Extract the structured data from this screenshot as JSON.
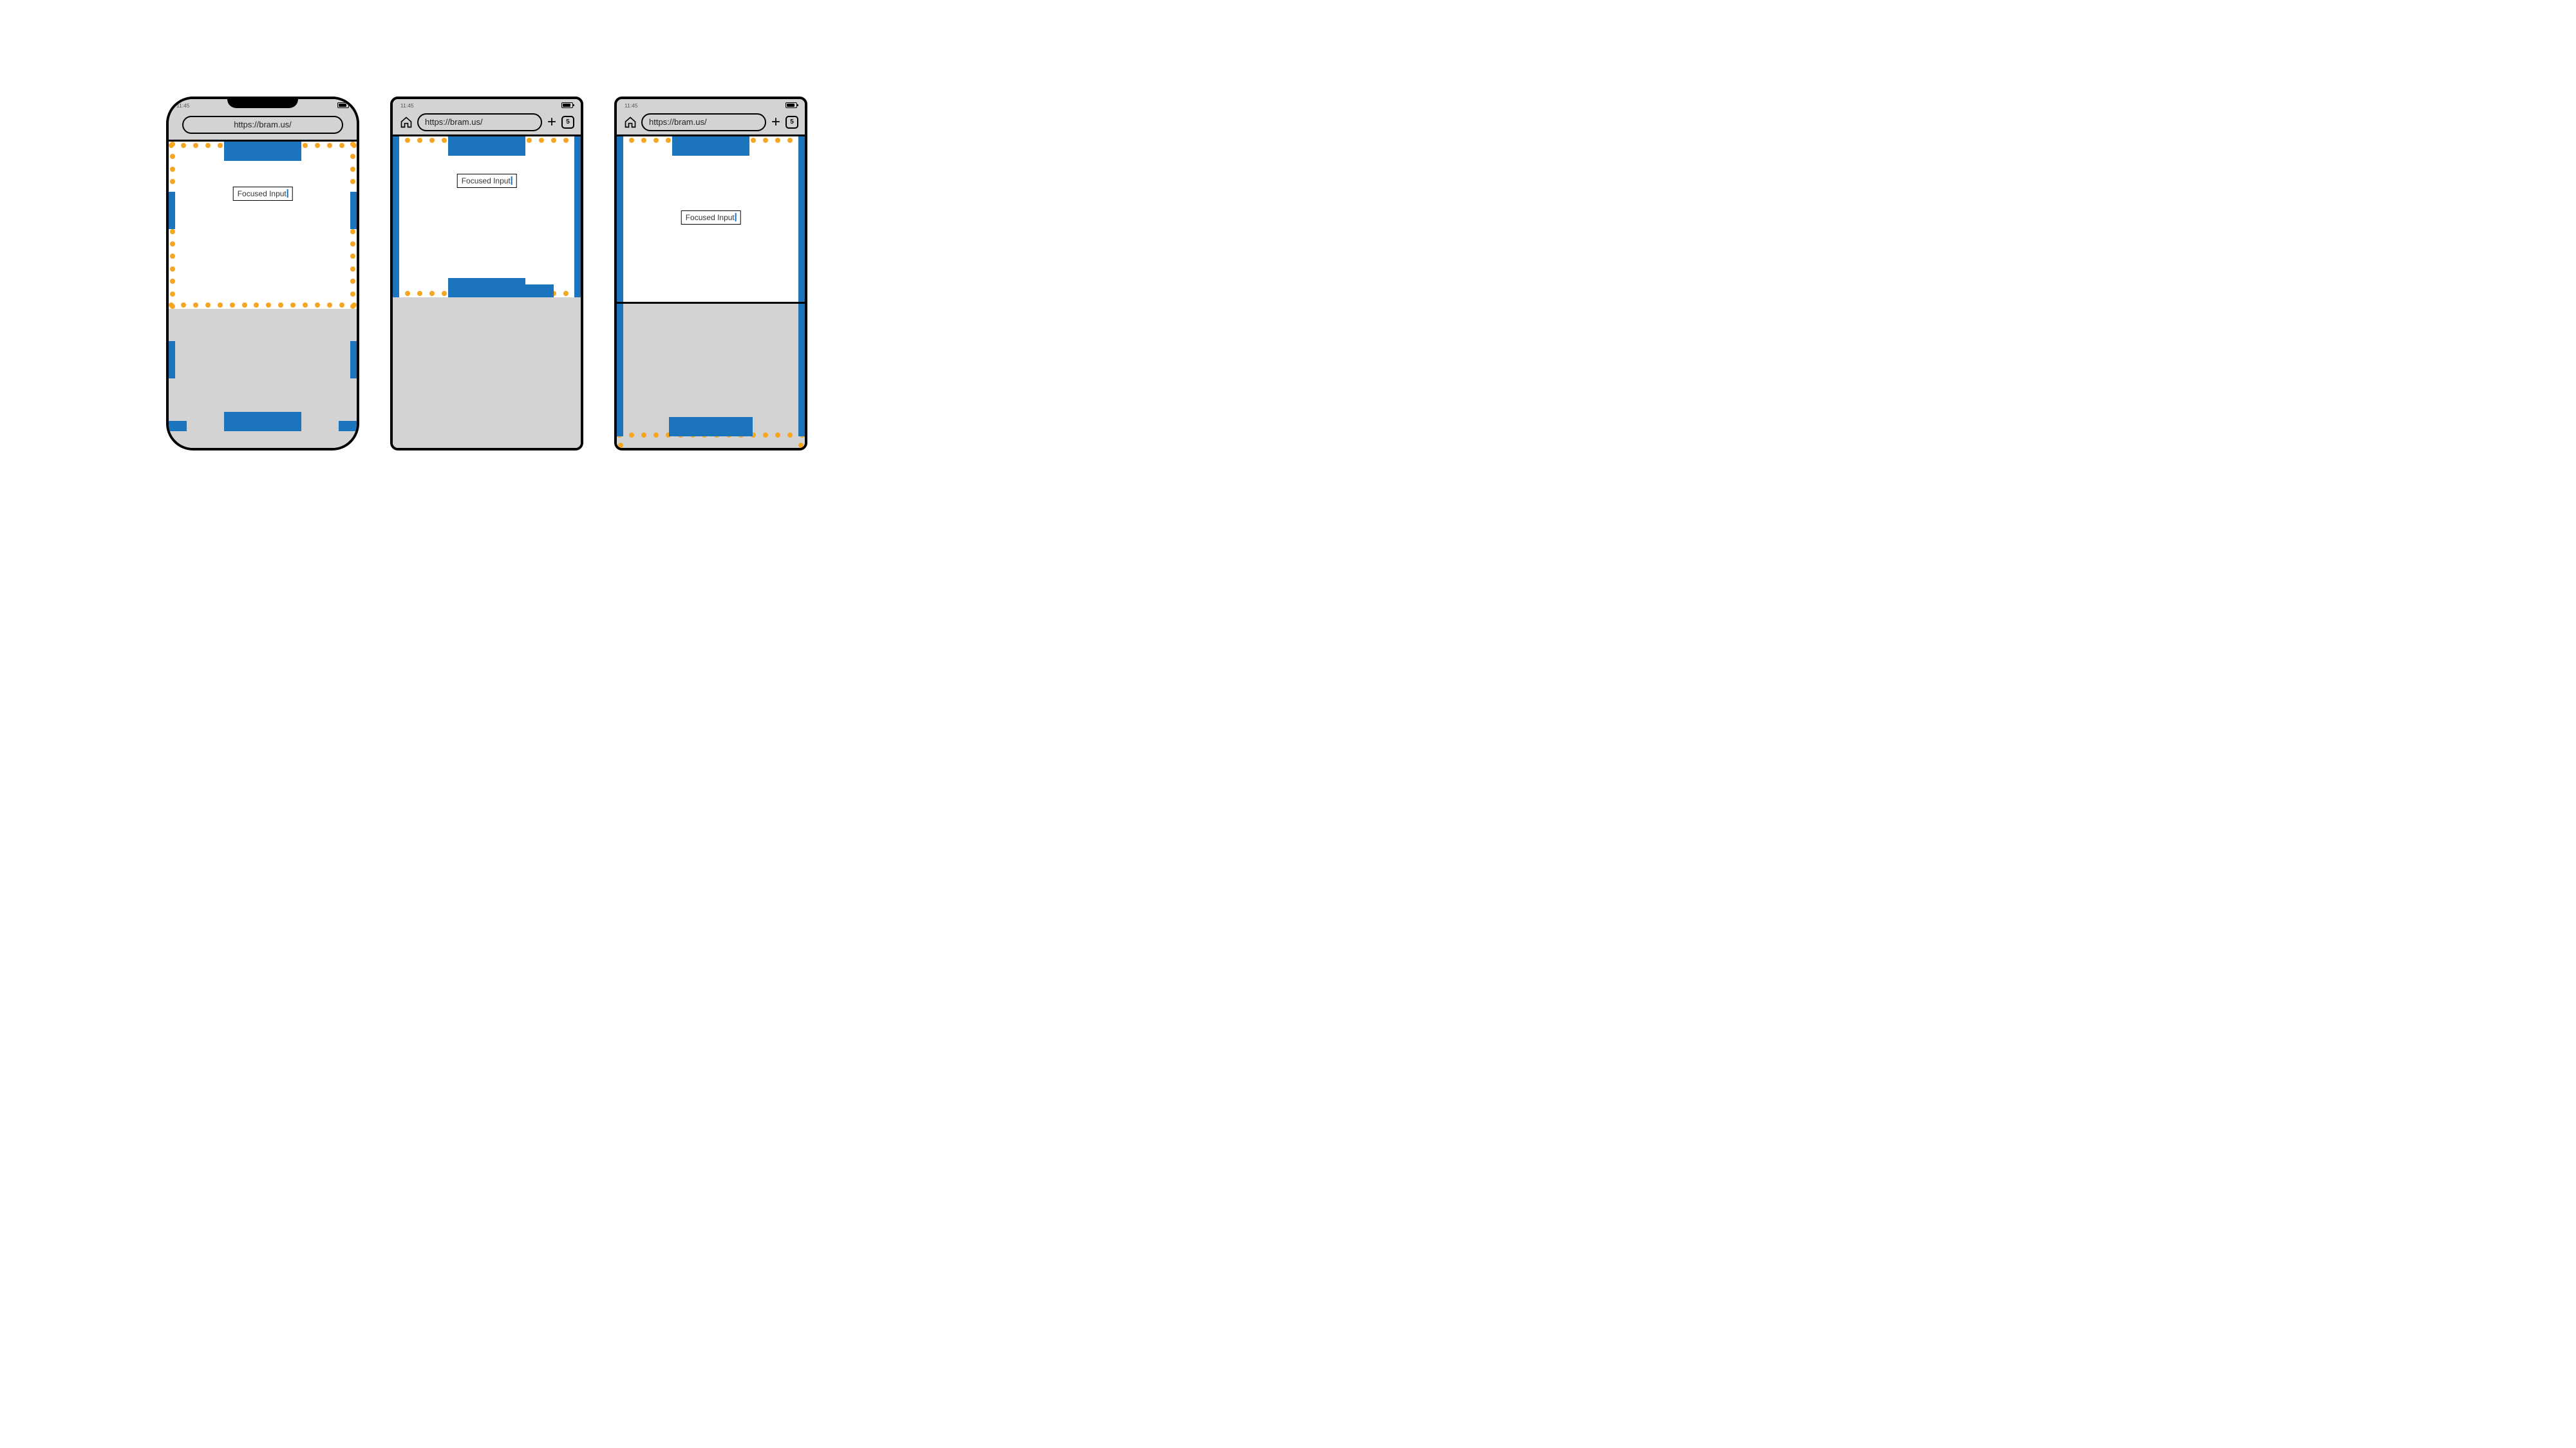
{
  "status": {
    "time": "11:45"
  },
  "url": "https://bram.us/",
  "tab_count": "5",
  "input_value": "Focused Input",
  "colors": {
    "accent_blue": "#1c75bc",
    "accent_orange": "#f5a623",
    "chrome_gray": "#d3d3d3"
  },
  "phones": {
    "p1": {
      "style": "ios-notch",
      "layout_viewport": "extends into keyboard (icb unchanged)",
      "visual_viewport": "above keyboard"
    },
    "p2": {
      "style": "android-like",
      "layout_viewport": "resized to above keyboard",
      "visual_viewport": "above keyboard"
    },
    "p3": {
      "style": "android-like",
      "layout_viewport": "extends into keyboard",
      "visual_viewport": "above keyboard"
    }
  }
}
